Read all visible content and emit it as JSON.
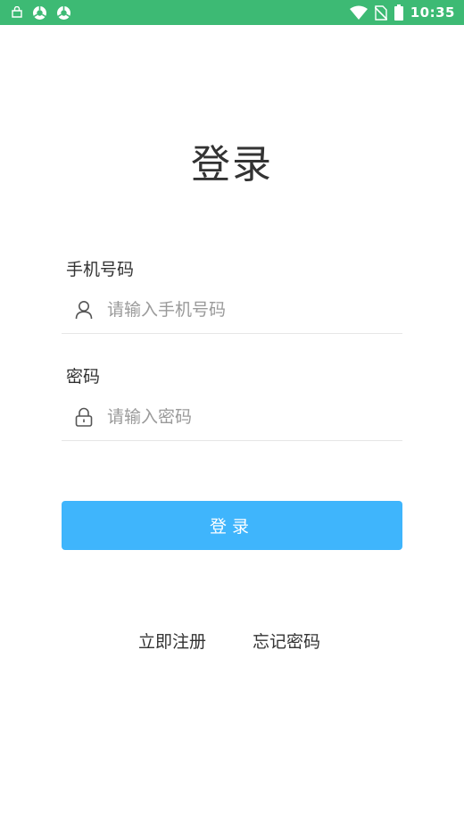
{
  "status_bar": {
    "time": "10:35",
    "color": "#3dba74",
    "icons_left": [
      "bag-icon",
      "chrome-icon",
      "chrome-icon"
    ],
    "icons_right": [
      "wifi-icon",
      "no-sim-icon",
      "battery-icon"
    ]
  },
  "title": "登录",
  "phone": {
    "label": "手机号码",
    "placeholder": "请输入手机号码",
    "value": "",
    "icon": "user-icon"
  },
  "password": {
    "label": "密码",
    "placeholder": "请输入密码",
    "value": "",
    "icon": "lock-icon"
  },
  "login_button": {
    "label": "登录",
    "color": "#3fb5fc"
  },
  "links": {
    "register": "立即注册",
    "forgot": "忘记密码"
  }
}
